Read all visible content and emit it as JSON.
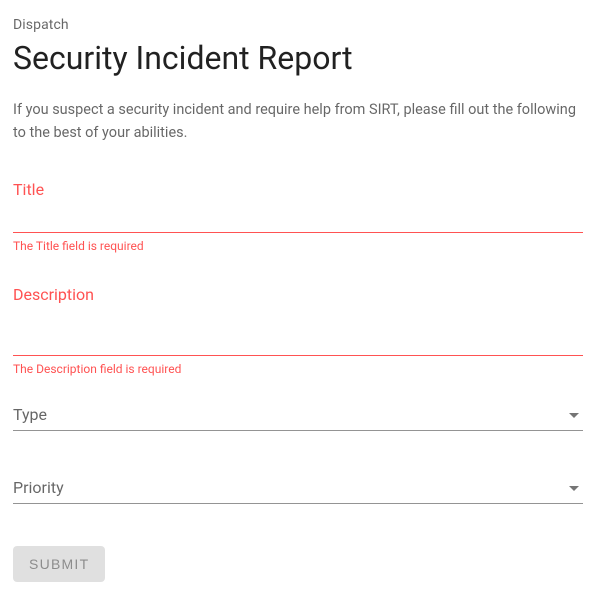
{
  "header": {
    "overline": "Dispatch",
    "title": "Security Incident Report",
    "intro": "If you suspect a security incident and require help from SIRT, please fill out the following to the best of your abilities."
  },
  "fields": {
    "title": {
      "label": "Title",
      "value": "",
      "error": "The Title field is required"
    },
    "description": {
      "label": "Description",
      "value": "",
      "error": "The Description field is required"
    },
    "type": {
      "label": "Type",
      "value": ""
    },
    "priority": {
      "label": "Priority",
      "value": ""
    }
  },
  "actions": {
    "submit": "Submit"
  },
  "colors": {
    "error": "#ff5252",
    "textPrimary": "rgba(0,0,0,0.87)",
    "textSecondary": "rgba(0,0,0,0.6)",
    "underline": "rgba(0,0,0,0.42)",
    "disabledBg": "rgba(0,0,0,0.12)",
    "disabledText": "rgba(0,0,0,0.38)"
  }
}
